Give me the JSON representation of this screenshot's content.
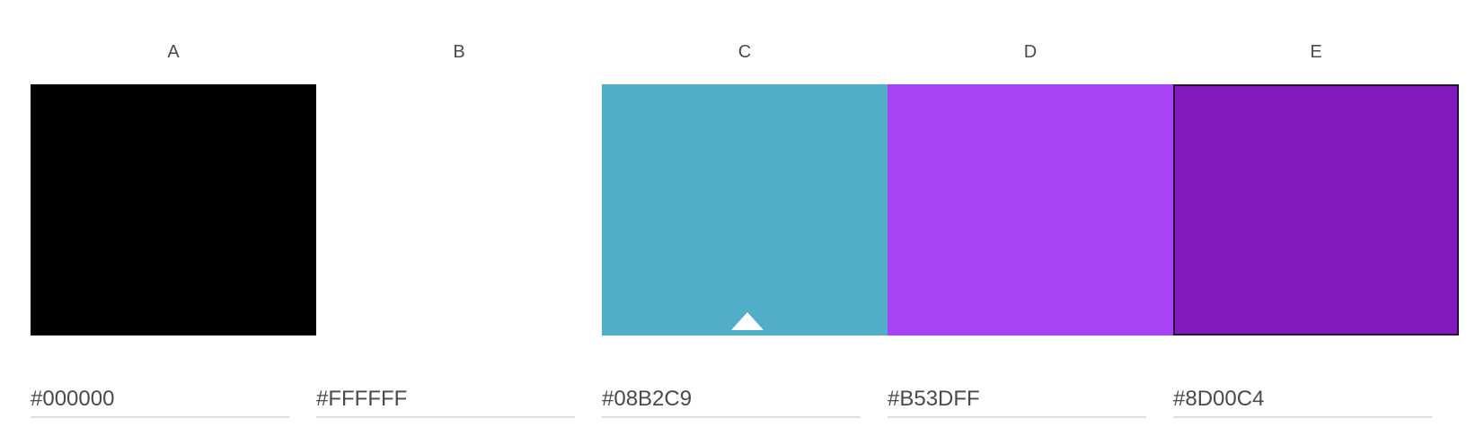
{
  "swatches": [
    {
      "label": "A",
      "color": "#000000",
      "hex": "#000000"
    },
    {
      "label": "B",
      "color": "#FFFFFF",
      "hex": "#FFFFFF"
    },
    {
      "label": "C",
      "color": "#52ADC8",
      "hex": "#08B2C9"
    },
    {
      "label": "D",
      "color": "#A643F5",
      "hex": "#B53DFF"
    },
    {
      "label": "E",
      "color": "#8219BD",
      "hex": "#8D00C4"
    }
  ],
  "selected_index": 2,
  "selected_marker_icon": "triangle-up-icon"
}
